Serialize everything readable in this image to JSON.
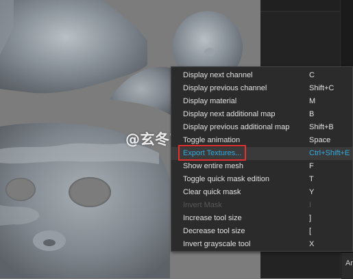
{
  "watermark": "@玄冬Wong",
  "context_menu": {
    "items": [
      {
        "label": "Display next channel",
        "shortcut": "C",
        "state": "normal"
      },
      {
        "label": "Display previous channel",
        "shortcut": "Shift+C",
        "state": "normal"
      },
      {
        "label": "Display material",
        "shortcut": "M",
        "state": "normal"
      },
      {
        "label": "Display next additional map",
        "shortcut": "B",
        "state": "normal"
      },
      {
        "label": "Display previous additional map",
        "shortcut": "Shift+B",
        "state": "normal"
      },
      {
        "label": "Toggle animation",
        "shortcut": "Space",
        "state": "normal"
      },
      {
        "label": "Export Textures...",
        "shortcut": "Ctrl+Shift+E",
        "state": "highlighted"
      },
      {
        "label": "Show entire mesh",
        "shortcut": "F",
        "state": "normal"
      },
      {
        "label": "Toggle quick mask edition",
        "shortcut": "T",
        "state": "normal"
      },
      {
        "label": "Clear quick mask",
        "shortcut": "Y",
        "state": "normal"
      },
      {
        "label": "Invert Mask",
        "shortcut": "I",
        "state": "disabled"
      },
      {
        "label": "Increase tool size",
        "shortcut": "]",
        "state": "normal"
      },
      {
        "label": "Decrease tool size",
        "shortcut": "[",
        "state": "normal"
      },
      {
        "label": "Invert grayscale tool",
        "shortcut": "X",
        "state": "normal"
      }
    ]
  },
  "side_panel": {
    "label": "An"
  },
  "colors": {
    "highlight_text": "#33aadd",
    "annotation_box": "#e3312f",
    "menu_bg": "#2b2b2b"
  }
}
